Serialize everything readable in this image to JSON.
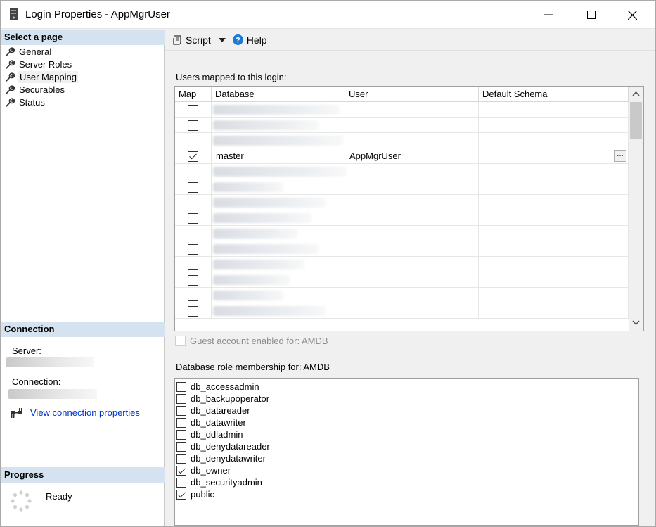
{
  "window": {
    "title": "Login Properties - AppMgrUser"
  },
  "left_panel": {
    "select_header": "Select a page",
    "pages": [
      {
        "label": "General",
        "selected": false
      },
      {
        "label": "Server Roles",
        "selected": false
      },
      {
        "label": "User Mapping",
        "selected": true
      },
      {
        "label": "Securables",
        "selected": false
      },
      {
        "label": "Status",
        "selected": false
      }
    ],
    "connection_header": "Connection",
    "server_label": "Server:",
    "connection_label": "Connection:",
    "view_connection_link": "View connection properties",
    "progress_header": "Progress",
    "progress_status": "Ready"
  },
  "toolbar": {
    "script_label": "Script",
    "help_label": "Help"
  },
  "users_section": {
    "label": "Users mapped to this login:",
    "columns": [
      "Map",
      "Database",
      "User",
      "Default Schema"
    ],
    "rows": [
      {
        "checked": false,
        "database": "",
        "user": "",
        "schema": "",
        "blurred": true,
        "blur_width": 180
      },
      {
        "checked": false,
        "database": "",
        "user": "",
        "schema": "",
        "blurred": true,
        "blur_width": 150
      },
      {
        "checked": false,
        "database": "",
        "user": "",
        "schema": "",
        "blurred": true,
        "blur_width": 185
      },
      {
        "checked": true,
        "database": "master",
        "user": "AppMgrUser",
        "schema": "",
        "blurred": false,
        "has_button": true
      },
      {
        "checked": false,
        "database": "",
        "user": "",
        "schema": "",
        "blurred": true,
        "blur_width": 190
      },
      {
        "checked": false,
        "database": "",
        "user": "",
        "schema": "",
        "blurred": true,
        "blur_width": 100
      },
      {
        "checked": false,
        "database": "",
        "user": "",
        "schema": "",
        "blurred": true,
        "blur_width": 160
      },
      {
        "checked": false,
        "database": "",
        "user": "",
        "schema": "",
        "blurred": true,
        "blur_width": 140
      },
      {
        "checked": false,
        "database": "",
        "user": "",
        "schema": "",
        "blurred": true,
        "blur_width": 120
      },
      {
        "checked": false,
        "database": "",
        "user": "",
        "schema": "",
        "blurred": true,
        "blur_width": 150
      },
      {
        "checked": false,
        "database": "",
        "user": "",
        "schema": "",
        "blurred": true,
        "blur_width": 130
      },
      {
        "checked": false,
        "database": "",
        "user": "",
        "schema": "",
        "blurred": true,
        "blur_width": 110
      },
      {
        "checked": false,
        "database": "",
        "user": "",
        "schema": "",
        "blurred": true,
        "blur_width": 100
      },
      {
        "checked": false,
        "database": "",
        "user": "",
        "schema": "",
        "blurred": true,
        "blur_width": 160
      }
    ],
    "more_indicator": "…"
  },
  "guest": {
    "label": "Guest account enabled for: AMDB",
    "checked": false,
    "disabled": true
  },
  "roles_section": {
    "label": "Database role membership for: AMDB",
    "roles": [
      {
        "name": "db_accessadmin",
        "checked": false
      },
      {
        "name": "db_backupoperator",
        "checked": false
      },
      {
        "name": "db_datareader",
        "checked": false
      },
      {
        "name": "db_datawriter",
        "checked": false
      },
      {
        "name": "db_ddladmin",
        "checked": false
      },
      {
        "name": "db_denydatareader",
        "checked": false
      },
      {
        "name": "db_denydatawriter",
        "checked": false
      },
      {
        "name": "db_owner",
        "checked": true
      },
      {
        "name": "db_securityadmin",
        "checked": false
      },
      {
        "name": "public",
        "checked": true
      }
    ]
  },
  "colors": {
    "section_header_bg": "#d5e3f0",
    "link": "#0033cc",
    "help_icon": "#1e78d6"
  },
  "icons": {
    "app": "server-icon",
    "page": "wrench-icon",
    "script": "script-icon",
    "help": "help-icon",
    "connection": "connection-icon",
    "progress": "spinner-icon"
  }
}
